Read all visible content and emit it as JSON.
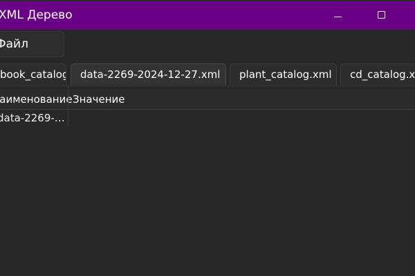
{
  "window": {
    "title": "XML Дерево"
  },
  "menubar": {
    "file_label": "Файл"
  },
  "tabs": [
    {
      "label": "book_catalog.xml"
    },
    {
      "label": "data-2269-2024-12-27.xml"
    },
    {
      "label": "plant_catalog.xml"
    },
    {
      "label": "cd_catalog.xml"
    }
  ],
  "tree": {
    "columns": {
      "name": "Наименование",
      "value": "Значение"
    },
    "rows": [
      {
        "name": "data-2269-…",
        "value": ""
      }
    ]
  },
  "colors": {
    "titlebar": "#6a0085",
    "background": "#272727"
  }
}
